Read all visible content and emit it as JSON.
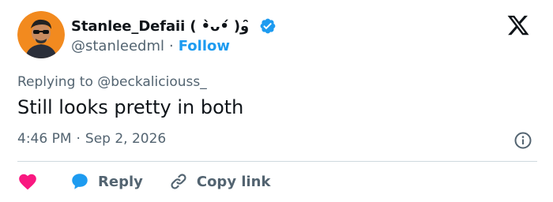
{
  "author": {
    "display_name": "Stanlee_Defaii ( •̀ᴗ•́ )و ̑̑",
    "handle": "@stanleedml",
    "separator": "·",
    "follow_label": "Follow"
  },
  "reply": {
    "prefix": "Replying to ",
    "user": "@beckaliciouss_"
  },
  "tweet": {
    "text": "Still looks pretty in both"
  },
  "meta": {
    "time": "4:46 PM",
    "separator": "·",
    "date": "Sep 2, 2026"
  },
  "actions": {
    "reply_label": "Reply",
    "copy_label": "Copy link"
  },
  "icons": {
    "avatar": "avatar-image",
    "verified": "verified-badge-icon",
    "logo": "x-logo-icon",
    "info": "info-icon",
    "like": "heart-icon",
    "reply": "speech-bubble-icon",
    "copy": "link-icon"
  },
  "colors": {
    "accent": "#1d9bf0",
    "like": "#f91880",
    "text": "#0f1419",
    "muted": "#536471",
    "divider": "#cfd9de"
  }
}
